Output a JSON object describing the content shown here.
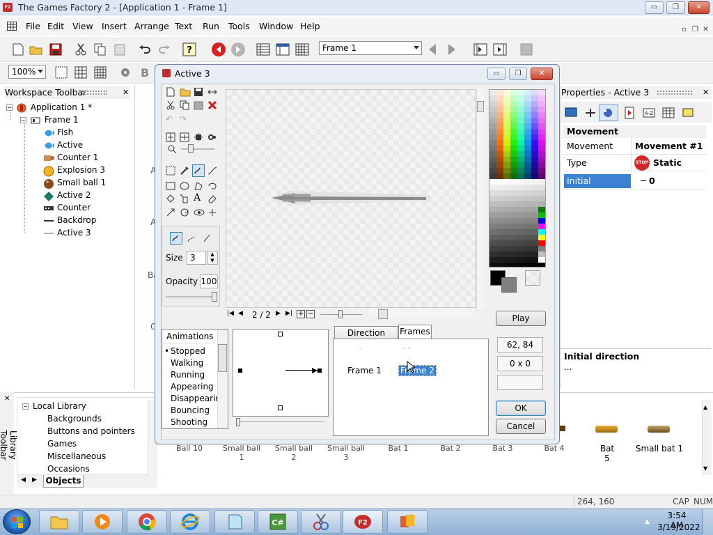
{
  "window": {
    "title": "The Games Factory 2 - [Application 1 - Frame 1]",
    "app_icon_text": "F2",
    "buttons": {
      "minimize": "▭",
      "restore": "❐",
      "close": "✕"
    }
  },
  "menu": {
    "items": [
      "File",
      "Edit",
      "View",
      "Insert",
      "Arrange",
      "Text",
      "Run",
      "Tools",
      "Window",
      "Help"
    ],
    "mdi_buttons": [
      "▫",
      "❐",
      "✕"
    ]
  },
  "toolbar": {
    "frame_combo": "Frame 1",
    "zoom_combo": "100%"
  },
  "workspace": {
    "title": "Workspace Toolbar",
    "close": "✕",
    "tree": [
      {
        "label": "Application 1 *",
        "icon": "application-icon"
      },
      {
        "label": "Frame 1",
        "icon": "frame-icon"
      },
      {
        "label": "Fish",
        "icon": "fish-icon"
      },
      {
        "label": "Active",
        "icon": "active-object-icon"
      },
      {
        "label": "Counter 1",
        "icon": "counter-icon"
      },
      {
        "label": "Explosion 3",
        "icon": "explosion-icon"
      },
      {
        "label": "Small ball 1",
        "icon": "ball-icon"
      },
      {
        "label": "Active 2",
        "icon": "diamond-icon"
      },
      {
        "label": "Counter",
        "icon": "counter-bar-icon"
      },
      {
        "label": "Backdrop",
        "icon": "backdrop-icon"
      },
      {
        "label": "Active 3",
        "icon": "line-object-icon"
      }
    ]
  },
  "library": {
    "side_label": "Library Toolbar",
    "close": "✕",
    "tree_root": "Local Library",
    "tree_items": [
      "Backgrounds",
      "Buttons and pointers",
      "Games",
      "Miscellaneous",
      "Occasions"
    ],
    "tab": "Objects",
    "objects": [
      "Ball 10",
      "Small ball 1",
      "Small ball 2",
      "Small ball 3",
      "Bat 1",
      "Bat 2",
      "Bat 3",
      "Bat 4",
      "Bat 5",
      "Small bat 1"
    ]
  },
  "properties": {
    "title": "Properties - Active 3",
    "close": "✕",
    "section": "Movement",
    "rows": [
      {
        "label": "Movement",
        "value": "Movement #1"
      },
      {
        "label": "Type",
        "value": "Static",
        "icon_text": "STOP"
      },
      {
        "label": "Initial direction",
        "value": "0"
      }
    ],
    "help_title": "Initial direction",
    "help_text": "..."
  },
  "dialog": {
    "title": "Active 3",
    "frame_nav": "2 / 2",
    "size_label": "Size",
    "size_value": "3",
    "opacity_label": "Opacity",
    "opacity_value": "100",
    "play_button": "Play",
    "hotspot": "62, 84",
    "dimensions": "0 x 0",
    "extra_field": "",
    "ok_button": "OK",
    "cancel_button": "Cancel",
    "animations_header": "Animations",
    "animations": [
      "Stopped",
      "Walking",
      "Running",
      "Appearing",
      "Disappearing",
      "Bouncing",
      "Shooting"
    ],
    "selected_animation": "Stopped",
    "tabs": [
      "Direction Options",
      "Frames"
    ],
    "frames": [
      "Frame 1",
      "Frame 2"
    ],
    "frame_marks": [
      "·",
      "·  ·"
    ]
  },
  "background_labels": [
    "A",
    "A",
    "Ba",
    "O"
  ],
  "statusbar": {
    "coords": "264, 160",
    "caps": "CAP",
    "num": "NUM"
  },
  "taskbar": {
    "time": "3:54 AM",
    "date": "3/19/2022",
    "apps": [
      "explorer",
      "media-player",
      "chrome",
      "internet-explorer",
      "notepad",
      "csharp",
      "paint",
      "games-factory",
      "office"
    ]
  },
  "palette": {
    "foreground": "#000000",
    "background": "#808080"
  }
}
